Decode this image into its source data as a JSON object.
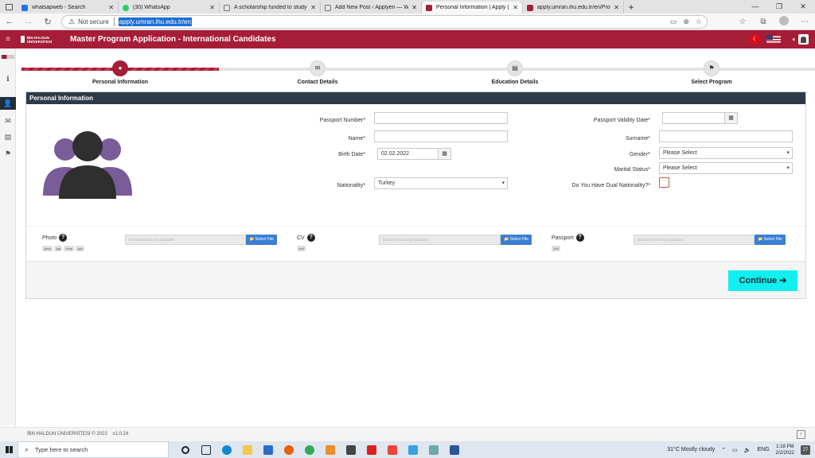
{
  "browser": {
    "tabs": [
      {
        "title": "whatsapweb - Search",
        "icon": "bing-icon",
        "color": "#1a73e8"
      },
      {
        "title": "(30) WhatsApp",
        "icon": "whatsapp-icon",
        "color": "#25d366"
      },
      {
        "title": "A scholarship funded to study at",
        "icon": "page-icon",
        "color": "#777777"
      },
      {
        "title": "Add New Post ‹ Applyen — Wor",
        "icon": "page-icon",
        "color": "#777777"
      },
      {
        "title": "Personal Information | Apply | Uc",
        "icon": "ihu-icon",
        "color": "#a51d37"
      },
      {
        "title": "apply.umran.ihu.edu.tr/en/Profil",
        "icon": "ihu-icon",
        "color": "#a51d37"
      }
    ],
    "active_tab_index": 4,
    "security_label": "Not secure",
    "url": "apply.umran.ihu.edu.tr/en"
  },
  "header": {
    "logo_text": "İBN HALDUN ÜNİVERSİTESİ",
    "title": "Master Program Application - International Candidates"
  },
  "steps": [
    {
      "label": "Personal Information",
      "icon": "user-icon",
      "active": true
    },
    {
      "label": "Contact Details",
      "icon": "envelope-icon",
      "active": false
    },
    {
      "label": "Education Details",
      "icon": "book-icon",
      "active": false
    },
    {
      "label": "Select Program",
      "icon": "flag-icon",
      "active": false
    }
  ],
  "progress_fraction": 0.25,
  "panel": {
    "title": "Personal Information"
  },
  "form": {
    "passport_number_label": "Passport Number*",
    "passport_number_value": "",
    "passport_validity_label": "Passport Validity Date*",
    "passport_validity_value": "",
    "name_label": "Name*",
    "name_value": "",
    "surname_label": "Surname*",
    "surname_value": "",
    "birth_date_label": "Birth Date*",
    "birth_date_value": "02.02.2022",
    "gender_label": "Gender*",
    "gender_value": "Please Select",
    "marital_label": "Marital Status*",
    "marital_value": "Please Select",
    "nationality_label": "Nationality*",
    "nationality_value": "Turkey",
    "dual_label": "Do You Have Dual Nationality?*"
  },
  "uploads": [
    {
      "label": "Photo",
      "exts": [
        ".jpeg",
        ".jpg",
        ".bmp",
        ".jpg"
      ],
      "placeholder": "Document was not uploaded",
      "button": "Select File"
    },
    {
      "label": "CV",
      "exts": [
        ".pdf"
      ],
      "placeholder": "Document was not uploaded",
      "button": "Select File"
    },
    {
      "label": "Passport",
      "exts": [
        ".pdf"
      ],
      "placeholder": "Document was not uploaded",
      "button": "Select File"
    }
  ],
  "continue_label": "Continue",
  "footer": {
    "copyright": "İBN HALDUN ÜNİVERSİTESİ © 2022",
    "version": "v1.0.24"
  },
  "taskbar": {
    "search_placeholder": "Type here to search",
    "weather": "31°C  Mostly cloudy",
    "lang": "ENG",
    "time": "1:18 PM",
    "date": "2/2/2022",
    "notifications": "27"
  },
  "colors": {
    "brand": "#a51d37",
    "panel_header": "#2e3a48",
    "continue_button": "#11f0f0",
    "upload_button": "#3a7fd5"
  }
}
